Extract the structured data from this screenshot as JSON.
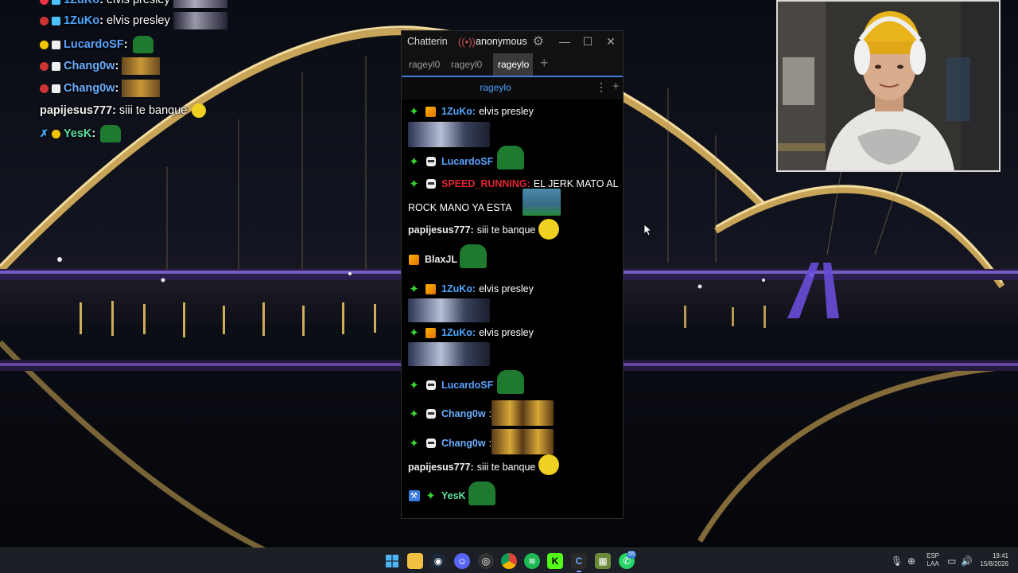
{
  "overlay_chat": [
    {
      "name": "1ZuKo",
      "message": "elvis presley",
      "name_color": "#4ea8ff",
      "emote": "elvis-gif"
    },
    {
      "name": "1ZuKo",
      "message": "elvis presley",
      "name_color": "#4ea8ff",
      "emote": "elvis-gif"
    },
    {
      "name": "LucardoSF",
      "message": "",
      "name_color": "#5ba3ff",
      "emote": "pepe"
    },
    {
      "name": "Chang0w",
      "message": "",
      "name_color": "#6ab0ff",
      "emote": "minions"
    },
    {
      "name": "Chang0w",
      "message": "",
      "name_color": "#6ab0ff",
      "emote": "minions"
    },
    {
      "name": "papijesus777",
      "message": "siii te banque",
      "name_color": "#f0f0f0",
      "emote": "emoji"
    },
    {
      "name": "YesK",
      "message": "",
      "name_color": "#58e0a0",
      "emote": "pepe"
    }
  ],
  "chatterino": {
    "app_title": "Chatterino",
    "account": "anonymous",
    "tabs": [
      "rageyl0",
      "rageyl0",
      "rageylo"
    ],
    "selected_tab": 2,
    "channel": "rageylo",
    "messages": [
      {
        "name": "1ZuKo",
        "text": "elvis presley",
        "color": "#4ea8ff",
        "badges": [
          "sparkle",
          "cube"
        ],
        "emote": "elvis-gif"
      },
      {
        "name": "LucardoSF",
        "text": "",
        "color": "#5ba3ff",
        "badges": [
          "sparkle",
          "robot"
        ],
        "emote": "pepe"
      },
      {
        "name": "SPEED_RUNNING",
        "text": "EL JERK MATO AL",
        "text2": "ROCK MANO YA ESTA",
        "color": "#e0242e",
        "badges": [
          "sparkle",
          "robot"
        ],
        "emote": "kid"
      },
      {
        "name": "papijesus777",
        "text": "siii te banque",
        "color": "#f0f0f0",
        "badges": [],
        "emote": "emoji"
      },
      {
        "name": "BlaxJL",
        "text": "",
        "color": "#e8e8e8",
        "badges": [
          "cube"
        ],
        "emote": "pepe"
      },
      {
        "name": "1ZuKo",
        "text": "elvis presley",
        "color": "#4ea8ff",
        "badges": [
          "sparkle",
          "cube"
        ],
        "emote": "elvis-gif"
      },
      {
        "name": "1ZuKo",
        "text": "elvis presley",
        "color": "#4ea8ff",
        "badges": [
          "sparkle",
          "cube"
        ],
        "emote": "elvis-gif"
      },
      {
        "name": "LucardoSF",
        "text": "",
        "color": "#5ba3ff",
        "badges": [
          "sparkle",
          "robot"
        ],
        "emote": "pepe"
      },
      {
        "name": "Chang0w",
        "text": "",
        "color": "#6ab0ff",
        "badges": [
          "sparkle",
          "robot"
        ],
        "emote": "minions"
      },
      {
        "name": "Chang0w",
        "text": "",
        "color": "#6ab0ff",
        "badges": [
          "sparkle",
          "robot"
        ],
        "emote": "minions"
      },
      {
        "name": "papijesus777",
        "text": "siii te banque",
        "color": "#f0f0f0",
        "badges": [],
        "emote": "emoji"
      },
      {
        "name": "YesK",
        "text": "",
        "color": "#58e0a0",
        "badges": [
          "hammer",
          "sparkle"
        ],
        "emote": "pepe"
      }
    ]
  },
  "taskbar": {
    "apps": [
      "windows-start",
      "file-explorer",
      "steam",
      "discord",
      "obs",
      "chrome",
      "spotify",
      "kick",
      "chatterino",
      "minecraft",
      "whatsapp"
    ],
    "whatsapp_badge": "55",
    "language": "ESP",
    "language_sub": "LAA",
    "time": "19:41",
    "date": "15/8/2026"
  }
}
